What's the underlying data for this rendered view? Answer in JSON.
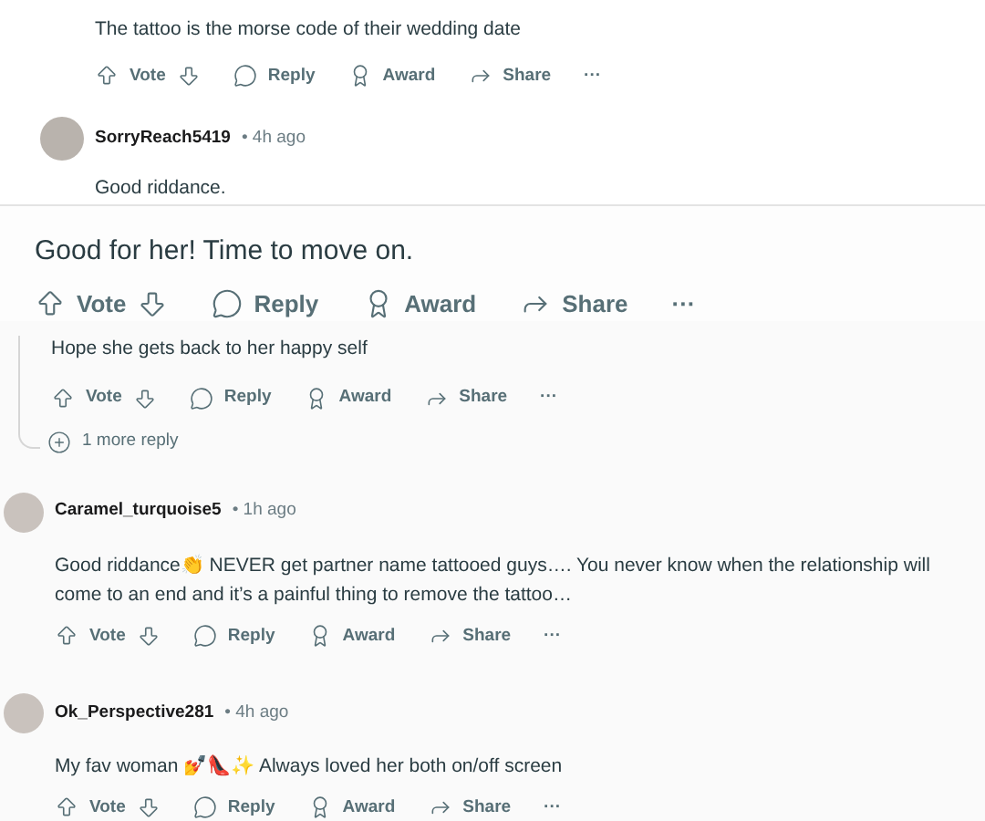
{
  "top_comment": {
    "body": "The tattoo is the morse code of their wedding date",
    "actions": [
      {
        "kind": "vote",
        "label": "Vote"
      },
      {
        "kind": "reply",
        "label": "Reply"
      },
      {
        "kind": "award",
        "label": "Award"
      },
      {
        "kind": "share",
        "label": "Share"
      },
      {
        "kind": "more",
        "label": "···"
      }
    ]
  },
  "reply": {
    "author": "SorryReach5419",
    "time": "• 4h ago",
    "body": "Good riddance."
  },
  "zoomed_comment": {
    "body": "Good for her! Time to move on.",
    "actions": [
      {
        "kind": "vote",
        "label": "Vote"
      },
      {
        "kind": "reply",
        "label": "Reply"
      },
      {
        "kind": "award",
        "label": "Award"
      },
      {
        "kind": "share",
        "label": "Share"
      },
      {
        "kind": "more",
        "label": "···"
      }
    ]
  },
  "thread_reply": {
    "body": "Hope she gets back to her happy self",
    "actions": [
      {
        "kind": "vote",
        "label": "Vote"
      },
      {
        "kind": "reply",
        "label": "Reply"
      },
      {
        "kind": "award",
        "label": "Award"
      },
      {
        "kind": "share",
        "label": "Share"
      },
      {
        "kind": "more",
        "label": "···"
      }
    ],
    "more_replies": "1 more reply"
  },
  "comments": [
    {
      "author": "Caramel_turquoise5",
      "time": "• 1h ago",
      "body": "Good riddance👏 NEVER get partner name tattooed guys…. You never know when the relationship will come to an end and it’s a painful thing to remove the tattoo…",
      "actions": [
        {
          "kind": "vote",
          "label": "Vote"
        },
        {
          "kind": "reply",
          "label": "Reply"
        },
        {
          "kind": "award",
          "label": "Award"
        },
        {
          "kind": "share",
          "label": "Share"
        },
        {
          "kind": "more",
          "label": "···"
        }
      ]
    },
    {
      "author": "Ok_Perspective281",
      "time": "• 4h ago",
      "body": "My fav woman 💅👠✨ Always loved her both on/off screen",
      "actions": [
        {
          "kind": "vote",
          "label": "Vote"
        },
        {
          "kind": "reply",
          "label": "Reply"
        },
        {
          "kind": "award",
          "label": "Award"
        },
        {
          "kind": "share",
          "label": "Share"
        },
        {
          "kind": "more",
          "label": "···"
        }
      ]
    }
  ]
}
